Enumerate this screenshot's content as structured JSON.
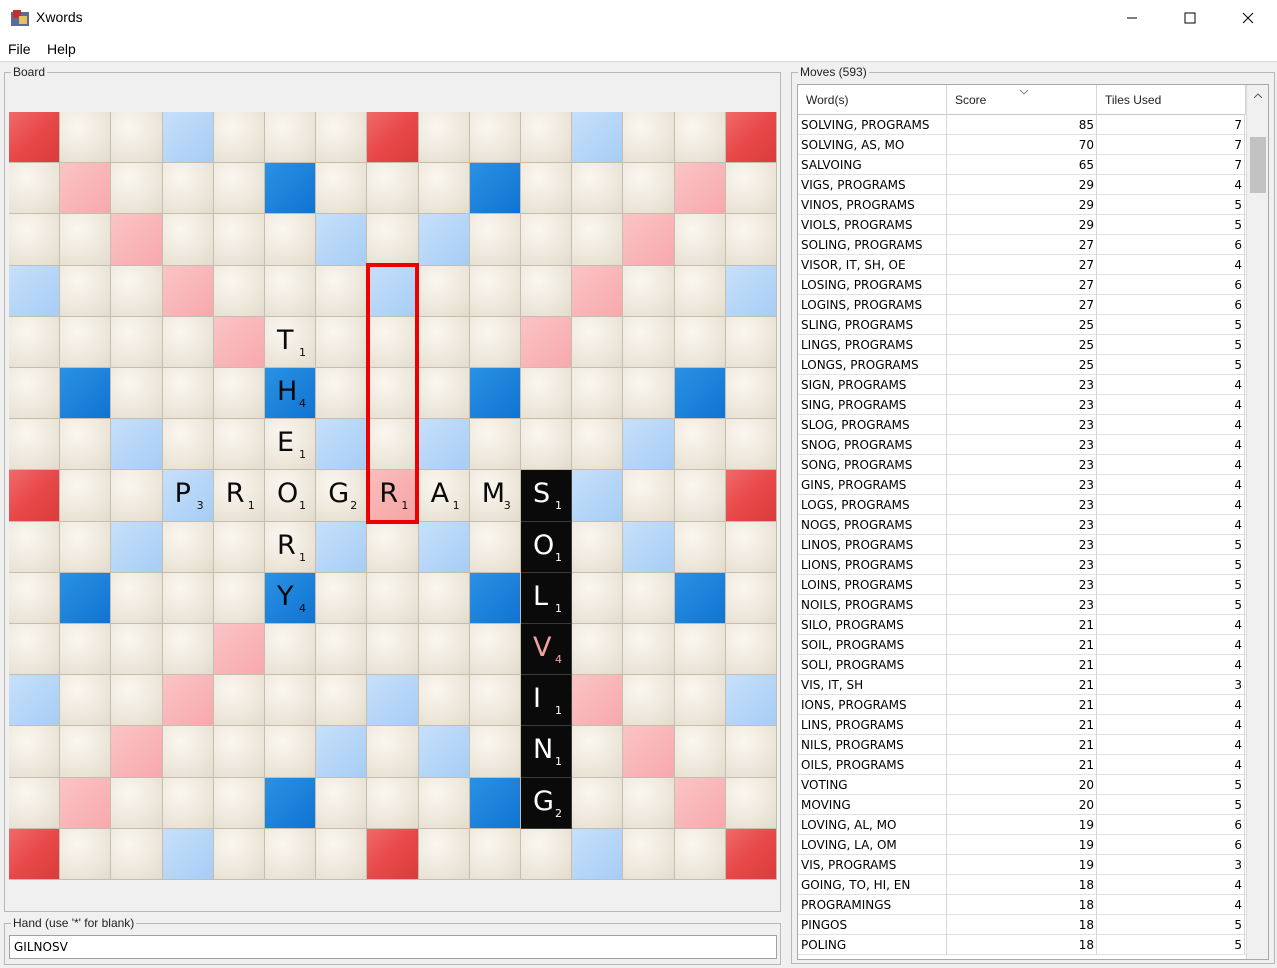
{
  "window": {
    "title": "Xwords"
  },
  "menu": {
    "file": "File",
    "help": "Help"
  },
  "board_panel": {
    "label": "Board"
  },
  "hand_panel": {
    "label": "Hand (use '*' for blank)",
    "value": "GILNOSV"
  },
  "moves_panel": {
    "label": "Moves (593)",
    "headers": {
      "words": "Word(s)",
      "score": "Score",
      "tiles": "Tiles Used"
    },
    "rows": [
      [
        "SOLVING, PROGRAMS",
        "85",
        "7"
      ],
      [
        "SOLVING, AS, MO",
        "70",
        "7"
      ],
      [
        "SALVOING",
        "65",
        "7"
      ],
      [
        "VIGS, PROGRAMS",
        "29",
        "4"
      ],
      [
        "VINOS, PROGRAMS",
        "29",
        "5"
      ],
      [
        "VIOLS, PROGRAMS",
        "29",
        "5"
      ],
      [
        "SOLING, PROGRAMS",
        "27",
        "6"
      ],
      [
        "VISOR, IT, SH, OE",
        "27",
        "4"
      ],
      [
        "LOSING, PROGRAMS",
        "27",
        "6"
      ],
      [
        "LOGINS, PROGRAMS",
        "27",
        "6"
      ],
      [
        "SLING, PROGRAMS",
        "25",
        "5"
      ],
      [
        "LINGS, PROGRAMS",
        "25",
        "5"
      ],
      [
        "LONGS, PROGRAMS",
        "25",
        "5"
      ],
      [
        "SIGN, PROGRAMS",
        "23",
        "4"
      ],
      [
        "SING, PROGRAMS",
        "23",
        "4"
      ],
      [
        "SLOG, PROGRAMS",
        "23",
        "4"
      ],
      [
        "SNOG, PROGRAMS",
        "23",
        "4"
      ],
      [
        "SONG, PROGRAMS",
        "23",
        "4"
      ],
      [
        "GINS, PROGRAMS",
        "23",
        "4"
      ],
      [
        "LOGS, PROGRAMS",
        "23",
        "4"
      ],
      [
        "NOGS, PROGRAMS",
        "23",
        "4"
      ],
      [
        "LINOS, PROGRAMS",
        "23",
        "5"
      ],
      [
        "LIONS, PROGRAMS",
        "23",
        "5"
      ],
      [
        "LOINS, PROGRAMS",
        "23",
        "5"
      ],
      [
        "NOILS, PROGRAMS",
        "23",
        "5"
      ],
      [
        "SILO, PROGRAMS",
        "21",
        "4"
      ],
      [
        "SOIL, PROGRAMS",
        "21",
        "4"
      ],
      [
        "SOLI, PROGRAMS",
        "21",
        "4"
      ],
      [
        "VIS, IT, SH",
        "21",
        "3"
      ],
      [
        "IONS, PROGRAMS",
        "21",
        "4"
      ],
      [
        "LINS, PROGRAMS",
        "21",
        "4"
      ],
      [
        "NILS, PROGRAMS",
        "21",
        "4"
      ],
      [
        "OILS, PROGRAMS",
        "21",
        "4"
      ],
      [
        "VOTING",
        "20",
        "5"
      ],
      [
        "MOVING",
        "20",
        "5"
      ],
      [
        "LOVING, AL, MO",
        "19",
        "6"
      ],
      [
        "LOVING, LA, OM",
        "19",
        "6"
      ],
      [
        "VIS, PROGRAMS",
        "19",
        "3"
      ],
      [
        "GOING, TO, HI, EN",
        "18",
        "4"
      ],
      [
        "PROGRAMINGS",
        "18",
        "4"
      ],
      [
        "PINGOS",
        "18",
        "5"
      ],
      [
        "POLING",
        "18",
        "5"
      ]
    ]
  },
  "board": {
    "premium_rows": [
      "TnnDnnnTnnnDnnT",
      "nWnnnLnnnLnnnWn",
      "nnWnnnDnDnnnWnn",
      "DnnWnnnDnnnWnnD",
      "nnnnWnnnnnWnnnn",
      "nLnnnLnnnLnnnLn",
      "nnDnnnDnDnnnDnn",
      "TnnDnnnWnnnDnnT",
      "nnDnnnDnDnnnDnn",
      "nLnnnLnnnLnnnLn",
      "nnnnWnnnnnWnnnn",
      "DnnWnnnDnnnWnnD",
      "nnWnnnDnDnnnWnn",
      "nWnnnLnnnLnnnWn",
      "TnnDnnnTnnnDnnT"
    ],
    "placed_tiles": [
      {
        "row": 4,
        "col": 5,
        "letter": "T",
        "value": "1",
        "style": "board"
      },
      {
        "row": 5,
        "col": 5,
        "letter": "H",
        "value": "4",
        "style": "board"
      },
      {
        "row": 6,
        "col": 5,
        "letter": "E",
        "value": "1",
        "style": "board"
      },
      {
        "row": 7,
        "col": 3,
        "letter": "P",
        "value": "3",
        "style": "board"
      },
      {
        "row": 7,
        "col": 4,
        "letter": "R",
        "value": "1",
        "style": "board"
      },
      {
        "row": 7,
        "col": 5,
        "letter": "O",
        "value": "1",
        "style": "board"
      },
      {
        "row": 7,
        "col": 6,
        "letter": "G",
        "value": "2",
        "style": "board"
      },
      {
        "row": 7,
        "col": 7,
        "letter": "R",
        "value": "1",
        "style": "board"
      },
      {
        "row": 7,
        "col": 8,
        "letter": "A",
        "value": "1",
        "style": "board"
      },
      {
        "row": 7,
        "col": 9,
        "letter": "M",
        "value": "3",
        "style": "board"
      },
      {
        "row": 7,
        "col": 10,
        "letter": "S",
        "value": "1",
        "style": "new"
      },
      {
        "row": 8,
        "col": 5,
        "letter": "R",
        "value": "1",
        "style": "board"
      },
      {
        "row": 8,
        "col": 10,
        "letter": "O",
        "value": "1",
        "style": "new"
      },
      {
        "row": 9,
        "col": 5,
        "letter": "Y",
        "value": "4",
        "style": "board"
      },
      {
        "row": 9,
        "col": 10,
        "letter": "L",
        "value": "1",
        "style": "new"
      },
      {
        "row": 10,
        "col": 10,
        "letter": "V",
        "value": "4",
        "style": "new-premium"
      },
      {
        "row": 11,
        "col": 10,
        "letter": "I",
        "value": "1",
        "style": "new"
      },
      {
        "row": 12,
        "col": 10,
        "letter": "N",
        "value": "1",
        "style": "new"
      },
      {
        "row": 13,
        "col": 10,
        "letter": "G",
        "value": "2",
        "style": "new"
      }
    ],
    "colors": {
      "triple_word": "#e84848",
      "double_word": "#f7a9ad",
      "triple_letter": "#1073d2",
      "double_letter": "#a7cdf4",
      "normal": "#ede7db",
      "new_tile": "#0a0a0a",
      "selection": "#ee0000"
    }
  }
}
